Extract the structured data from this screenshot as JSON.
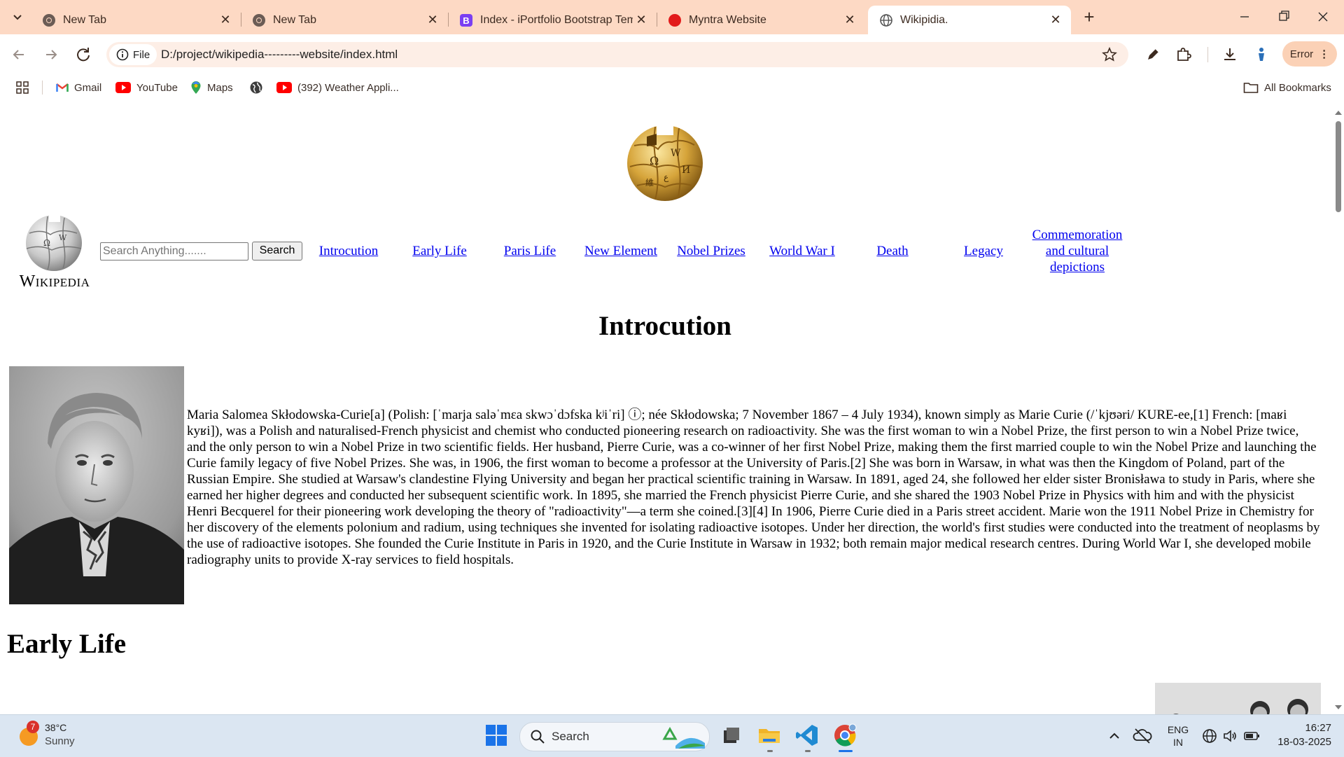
{
  "browser": {
    "tabs": [
      {
        "title": "New Tab",
        "icon": "chrome-icon"
      },
      {
        "title": "New Tab",
        "icon": "chrome-icon"
      },
      {
        "title": "Index - iPortfolio Bootstrap Tem",
        "icon": "bootstrap-icon"
      },
      {
        "title": "Myntra Website",
        "icon": "record-icon"
      },
      {
        "title": "Wikipidia.",
        "icon": "globe-icon",
        "active": true
      }
    ],
    "url_chip": "File",
    "url": "D:/project/wikipedia---------website/index.html",
    "profile_label": "Error",
    "bookmarks": [
      {
        "label": "Gmail",
        "icon": "gmail-icon"
      },
      {
        "label": "YouTube",
        "icon": "youtube-icon"
      },
      {
        "label": "Maps",
        "icon": "maps-icon"
      },
      {
        "label": "",
        "icon": "globe-icon"
      },
      {
        "label": "(392) Weather Appli...",
        "icon": "youtube-icon"
      }
    ],
    "all_bookmarks": "All Bookmarks"
  },
  "page": {
    "wordmark": "Wikipedia",
    "search_placeholder": "Search Anything.......",
    "search_button": "Search",
    "nav": [
      "Introcution",
      "Early Life",
      "Paris Life",
      "New Element",
      "Nobel Prizes",
      "World War I",
      "Death",
      "Legacy",
      "Commemoration and cultural depictions"
    ],
    "heading": "Introcution",
    "intro_paragraph": "Maria Salomea Skłodowska-Curie[a] (Polish: [ˈmarja saləˈmɛa skwɔˈdɔfska kʲiˈri] ⓘ; née Skłodowska; 7 November 1867 – 4 July 1934), known simply as Marie Curie (/ˈkjʊəri/ KURE-ee,[1] French: [maʁi kyʁi]), was a Polish and naturalised-French physicist and chemist who conducted pioneering research on radioactivity. She was the first woman to win a Nobel Prize, the first person to win a Nobel Prize twice, and the only person to win a Nobel Prize in two scientific fields. Her husband, Pierre Curie, was a co-winner of her first Nobel Prize, making them the first married couple to win the Nobel Prize and launching the Curie family legacy of five Nobel Prizes. She was, in 1906, the first woman to become a professor at the University of Paris.[2] She was born in Warsaw, in what was then the Kingdom of Poland, part of the Russian Empire. She studied at Warsaw's clandestine Flying University and began her practical scientific training in Warsaw. In 1891, aged 24, she followed her elder sister Bronisława to study in Paris, where she earned her higher degrees and conducted her subsequent scientific work. In 1895, she married the French physicist Pierre Curie, and she shared the 1903 Nobel Prize in Physics with him and with the physicist Henri Becquerel for their pioneering work developing the theory of \"radioactivity\"—a term she coined.[3][4] In 1906, Pierre Curie died in a Paris street accident. Marie won the 1911 Nobel Prize in Chemistry for her discovery of the elements polonium and radium, using techniques she invented for isolating radioactive isotopes. Under her direction, the world's first studies were conducted into the treatment of neoplasms by the use of radioactive isotopes. She founded the Curie Institute in Paris in 1920, and the Curie Institute in Warsaw in 1932; both remain major medical research centres. During World War I, she developed mobile radiography units to provide X-ray services to field hospitals.",
    "heading2": "Early Life"
  },
  "taskbar": {
    "weather_temp": "38°C",
    "weather_desc": "Sunny",
    "weather_badge": "7",
    "search_label": "Search",
    "lang_line1": "ENG",
    "lang_line2": "IN",
    "time": "16:27",
    "date": "18-03-2025"
  }
}
